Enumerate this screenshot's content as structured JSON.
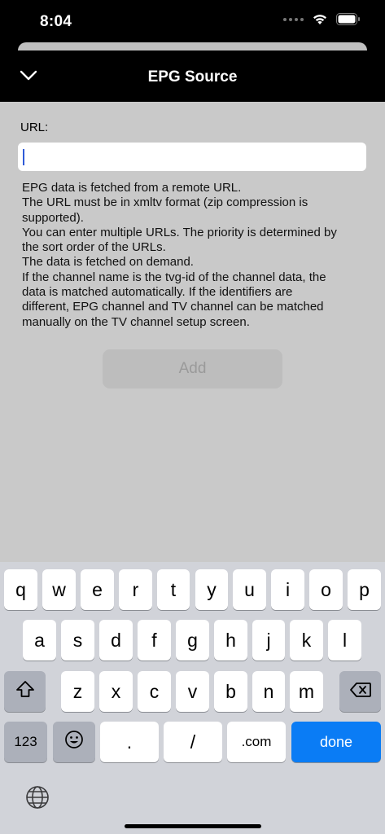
{
  "status_bar": {
    "time": "8:04"
  },
  "nav": {
    "title": "EPG Source"
  },
  "form": {
    "url_label": "URL:",
    "url_value": "",
    "help_lines": [
      "EPG data is fetched from a remote URL.",
      "The URL must be in xmltv format (zip compression is",
      "supported).",
      "You can enter multiple URLs. The priority is determined by",
      "the sort order of the URLs.",
      "The data is fetched on demand.",
      "If the channel name is the tvg-id of the channel data, the",
      "data is matched automatically. If the identifiers are",
      "different, EPG channel and TV channel can be matched",
      "manually on the TV channel setup screen."
    ],
    "add_label": "Add"
  },
  "keyboard": {
    "row1": [
      "q",
      "w",
      "e",
      "r",
      "t",
      "y",
      "u",
      "i",
      "o",
      "p"
    ],
    "row2": [
      "a",
      "s",
      "d",
      "f",
      "g",
      "h",
      "j",
      "k",
      "l"
    ],
    "row3": [
      "z",
      "x",
      "c",
      "v",
      "b",
      "n",
      "m"
    ],
    "numbers_label": "123",
    "period_label": ".",
    "slash_label": "/",
    "dotcom_label": ".com",
    "done_label": "done",
    "icons": [
      "shift-icon",
      "backspace-icon",
      "emoji-icon",
      "globe-icon"
    ]
  },
  "colors": {
    "accent": "#0a7cf5",
    "caret": "#2f5bd8"
  }
}
